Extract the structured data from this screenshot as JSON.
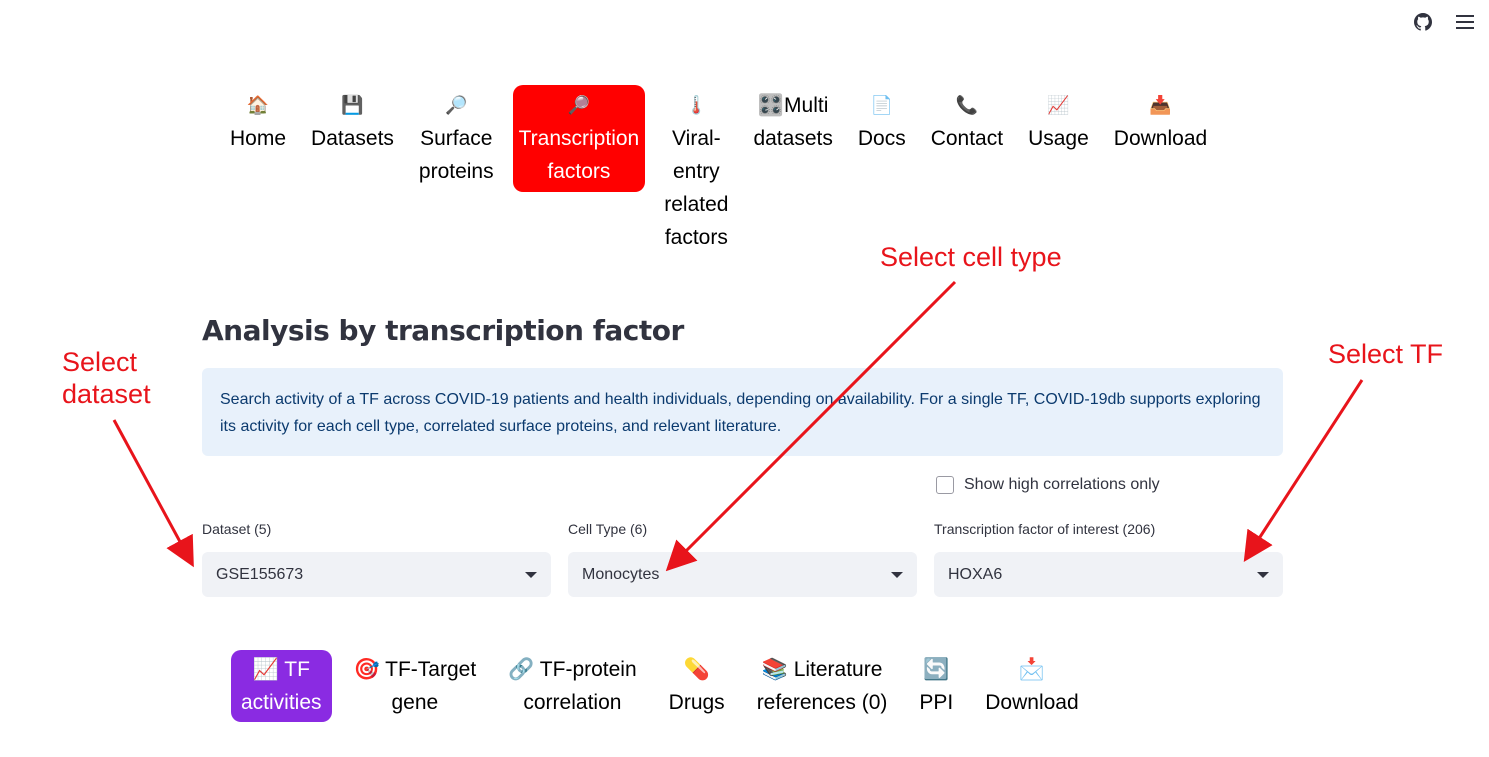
{
  "header": {
    "icons": [
      "github-icon",
      "hamburger-menu-icon"
    ]
  },
  "nav": {
    "items": [
      {
        "emoji": "🏠",
        "label": "Home"
      },
      {
        "emoji": "💾",
        "label": "Datasets"
      },
      {
        "emoji": "🔎",
        "label": "Surface\nproteins"
      },
      {
        "emoji": "🔎",
        "label": "Transcription\nfactors"
      },
      {
        "emoji": "🌡️",
        "label": "Viral-\nentry\nrelated\nfactors"
      },
      {
        "emoji": "🎛️",
        "label": "Multi\ndatasets"
      },
      {
        "emoji": "📄",
        "label": "Docs"
      },
      {
        "emoji": "📞",
        "label": "Contact"
      },
      {
        "emoji": "📈",
        "label": "Usage"
      },
      {
        "emoji": "📥",
        "label": "Download"
      }
    ],
    "active_index": 3,
    "active_color": "#ff0000"
  },
  "main": {
    "title": "Analysis by transcription factor",
    "info": "Search activity of a TF across COVID-19 patients and health individuals, depending on availability. For a single TF, COVID-19db supports exploring its activity for each cell type, correlated surface proteins, and relevant literature.",
    "checkbox_label": "Show high correlations only",
    "dataset_label": "Dataset (5)",
    "dataset_value": "GSE155673",
    "celltype_label": "Cell Type (6)",
    "celltype_value": "Monocytes",
    "tf_label": "Transcription factor of interest (206)",
    "tf_value": "HOXA6"
  },
  "tabs": {
    "items": [
      {
        "emoji": "📈",
        "label": "TF\nactivities"
      },
      {
        "emoji": "🎯",
        "label": "TF-Target\ngene"
      },
      {
        "emoji": "🔗",
        "label": "TF-protein\ncorrelation"
      },
      {
        "emoji": "💊",
        "label": "Drugs"
      },
      {
        "emoji": "📚",
        "label": "Literature\nreferences (0)"
      },
      {
        "emoji": "🔄",
        "label": "PPI"
      },
      {
        "emoji": "📩",
        "label": "Download"
      }
    ],
    "active_index": 0,
    "active_color": "#8a2be2"
  },
  "annotations": {
    "select_dataset": "Select\ndataset",
    "select_cell_type": "Select cell type",
    "select_tf": "Select TF",
    "color": "#e8141b"
  }
}
